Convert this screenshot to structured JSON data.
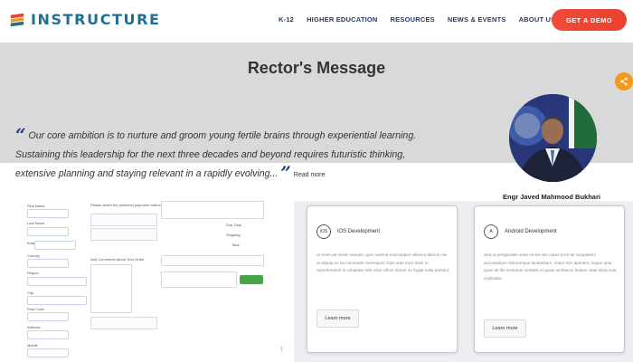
{
  "header": {
    "logo_text": "INSTRUCTURE",
    "nav": [
      "K-12",
      "HIGHER EDUCATION",
      "RESOURCES",
      "NEWS & EVENTS",
      "ABOUT US"
    ],
    "demo_label": "GET A DEMO"
  },
  "hero": {
    "title": "Rector's Message",
    "quote": "Our core ambition is to nurture and groom young fertile brains through experiential learning. Sustaining this leadership for the next three decades and beyond requires futuristic thinking, extensive planning and staying relevant in a rapidly evolving...",
    "read_more": "Read more",
    "name": "Engr Javed Mahmood Bukhari"
  },
  "cards": [
    {
      "icon_text": "iOS",
      "title": "iOS Development",
      "body": "Ut enim ad minim veniam, quis nostrud exercitation ullamco laboris nisi ut aliquip ex ea commodo consequat. Duis aute irure dolor in reprehenderit in voluptate velit esse cillum dolore eu fugiat nulla pariatur.",
      "button": "Learn more"
    },
    {
      "icon_text": "A",
      "title": "Android Development",
      "body": "Sed ut perspiciatis unde omnis iste natus error sit voluptatem accusantium doloremque laudantium, totam rem aperiam, eaque ipsa quae ab illo inventore veritatis et quasi architecto beatae vitae dicta sunt explicabo.",
      "button": "Learn more"
    }
  ],
  "colors": {
    "accent_orange": "#f39a1e",
    "demo_red": "#e8412f",
    "nav_blue": "#1f3b6e",
    "logo_teal": "#1f6f8f",
    "hero_gray": "#d9d9d9",
    "quote_mark": "#1c3f7a"
  },
  "icons": {
    "logo": "instructure-logo-icon",
    "share": "share-icon",
    "up": "arrow-up-icon"
  }
}
